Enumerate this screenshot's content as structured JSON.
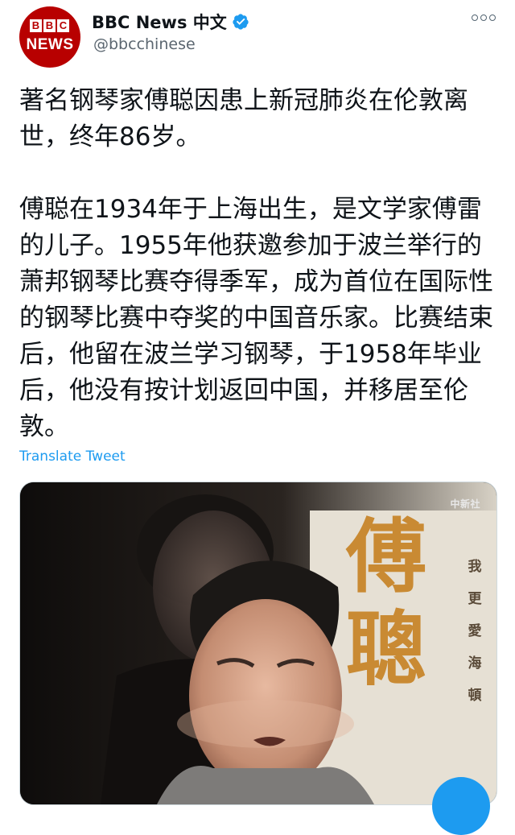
{
  "header": {
    "avatar_logo": "BBC NEWS",
    "display_name": "BBC News 中文",
    "handle": "@bbcchinese"
  },
  "tweet": {
    "text": "著名钢琴家傅聪因患上新冠肺炎在伦敦离世，终年86岁。\n\n傅聪在1934年于上海出生，是文学家傅雷的儿子。1955年他获邀参加于波兰举行的萧邦钢琴比赛夺得季军，成为首位在国际性的钢琴比赛中夺奖的中国音乐家。比赛结束后，他留在波兰学习钢琴，于1958年毕业后，他没有按计划返回中国，并移居至伦敦。",
    "translate_label": "Translate Tweet"
  },
  "media": {
    "watermark": "中新社",
    "poster_title": [
      "傅",
      "聰"
    ],
    "poster_side_text": "我更愛海頓"
  },
  "colors": {
    "accent": "#1d9bf0",
    "bbc_red": "#b80000",
    "text": "#0f1419",
    "secondary": "#5b6670"
  },
  "icons": {
    "verified": "verified-badge-icon",
    "more": "more-options-icon"
  }
}
